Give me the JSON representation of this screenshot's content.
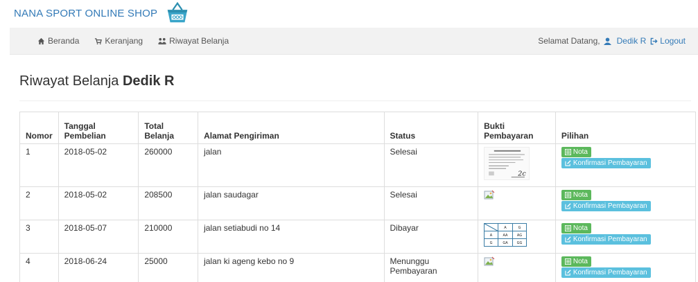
{
  "brand": {
    "name": "NANA SPORT ONLINE SHOP",
    "logo_icon": "basket-icon",
    "color": "#337ab7"
  },
  "nav": {
    "items": [
      {
        "label": "Beranda",
        "icon": "home-icon"
      },
      {
        "label": "Keranjang",
        "icon": "cart-icon"
      },
      {
        "label": "Riwayat Belanja",
        "icon": "history-icon"
      }
    ],
    "welcome": "Selamat Datang,",
    "user": "Dedik R",
    "logout": "Logout"
  },
  "page": {
    "title_prefix": "Riwayat Belanja",
    "title_name": "Dedik R"
  },
  "table": {
    "headers": [
      "Nomor",
      "Tanggal Pembelian",
      "Total Belanja",
      "Alamat Pengiriman",
      "Status",
      "Bukti Pembayaran",
      "Pilihan"
    ],
    "rows": [
      {
        "no": "1",
        "date": "2018-05-02",
        "total": "260000",
        "address": "jalan",
        "status": "Selesai",
        "proof": "document-thumbnail"
      },
      {
        "no": "2",
        "date": "2018-05-02",
        "total": "208500",
        "address": "jalan saudagar",
        "status": "Selesai",
        "proof": "broken-image-icon"
      },
      {
        "no": "3",
        "date": "2018-05-07",
        "total": "210000",
        "address": "jalan setiabudi no 14",
        "status": "Dibayar",
        "proof": "grid-thumbnail"
      },
      {
        "no": "4",
        "date": "2018-06-24",
        "total": "25000",
        "address": "jalan ki ageng kebo no 9",
        "status": "Menunggu Pembayaran",
        "proof": "broken-image-icon"
      }
    ],
    "btn_nota": "Nota",
    "btn_konfirmasi": "Konfirmasi Pembayaran"
  },
  "proof_grid": {
    "header": [
      "A",
      "G"
    ],
    "rows": [
      [
        "A",
        "AA",
        "AG"
      ],
      [
        "G",
        "GA",
        "GG"
      ]
    ]
  },
  "colors": {
    "nota": "#5cb85c",
    "konfirmasi": "#5bc0de",
    "link": "#337ab7"
  }
}
